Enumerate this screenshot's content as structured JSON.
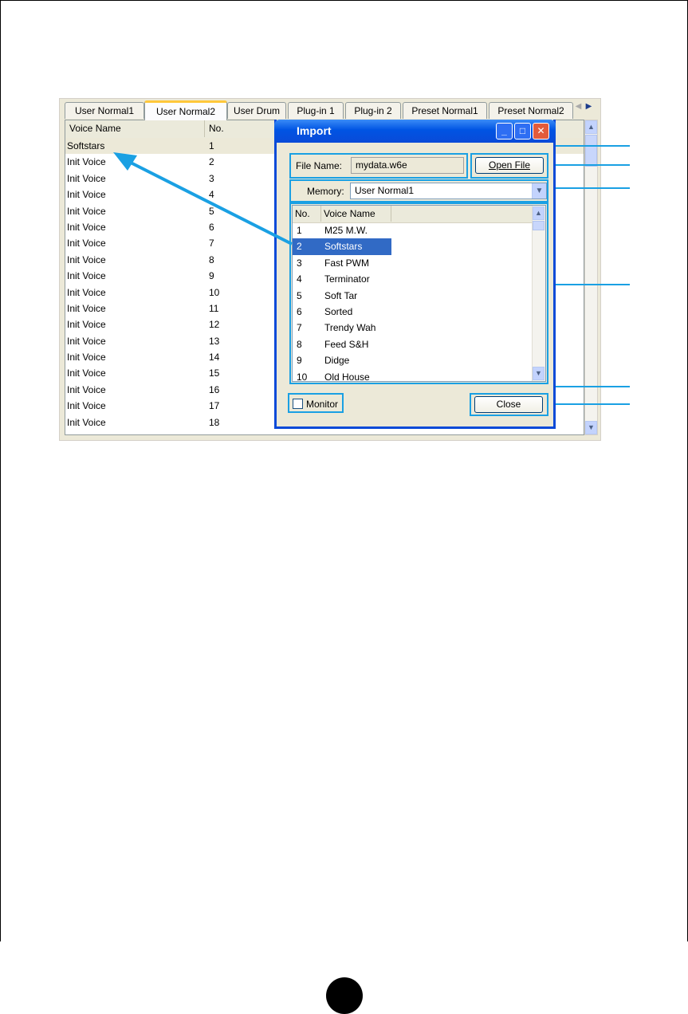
{
  "tabs": [
    "User Normal1",
    "User Normal2",
    "User Drum",
    "Plug-in 1",
    "Plug-in 2",
    "Preset Normal1",
    "Preset Normal2"
  ],
  "active_tab_index": 1,
  "list": {
    "col_voice_name": "Voice Name",
    "col_no": "No.",
    "rows": [
      {
        "name": "Softstars",
        "no": "1"
      },
      {
        "name": "Init Voice",
        "no": "2"
      },
      {
        "name": "Init Voice",
        "no": "3"
      },
      {
        "name": "Init Voice",
        "no": "4"
      },
      {
        "name": "Init Voice",
        "no": "5"
      },
      {
        "name": "Init Voice",
        "no": "6"
      },
      {
        "name": "Init Voice",
        "no": "7"
      },
      {
        "name": "Init Voice",
        "no": "8"
      },
      {
        "name": "Init Voice",
        "no": "9"
      },
      {
        "name": "Init Voice",
        "no": "10"
      },
      {
        "name": "Init Voice",
        "no": "11"
      },
      {
        "name": "Init Voice",
        "no": "12"
      },
      {
        "name": "Init Voice",
        "no": "13"
      },
      {
        "name": "Init Voice",
        "no": "14"
      },
      {
        "name": "Init Voice",
        "no": "15"
      },
      {
        "name": "Init Voice",
        "no": "16"
      },
      {
        "name": "Init Voice",
        "no": "17"
      },
      {
        "name": "Init Voice",
        "no": "18"
      }
    ]
  },
  "dialog": {
    "title": "Import",
    "file_name_label": "File Name:",
    "file_name_value": "mydata.w6e",
    "open_file_label": "Open File",
    "memory_label": "Memory:",
    "memory_value": "User Normal1",
    "list_col_no": "No.",
    "list_col_voice": "Voice Name",
    "voices": [
      {
        "no": "1",
        "name": "M25  M.W."
      },
      {
        "no": "2",
        "name": "Softstars"
      },
      {
        "no": "3",
        "name": "Fast PWM"
      },
      {
        "no": "4",
        "name": "Terminator"
      },
      {
        "no": "5",
        "name": "Soft Tar"
      },
      {
        "no": "6",
        "name": "Sorted"
      },
      {
        "no": "7",
        "name": "Trendy Wah"
      },
      {
        "no": "8",
        "name": "Feed S&H"
      },
      {
        "no": "9",
        "name": "Didge"
      },
      {
        "no": "10",
        "name": "Old House"
      }
    ],
    "selected_voice_index": 1,
    "monitor_label": "Monitor",
    "monitor_checked": false,
    "close_label": "Close"
  },
  "colors": {
    "callout": "#1aa0e3",
    "selection": "#316ac5",
    "titlebar": "#0054e3"
  }
}
